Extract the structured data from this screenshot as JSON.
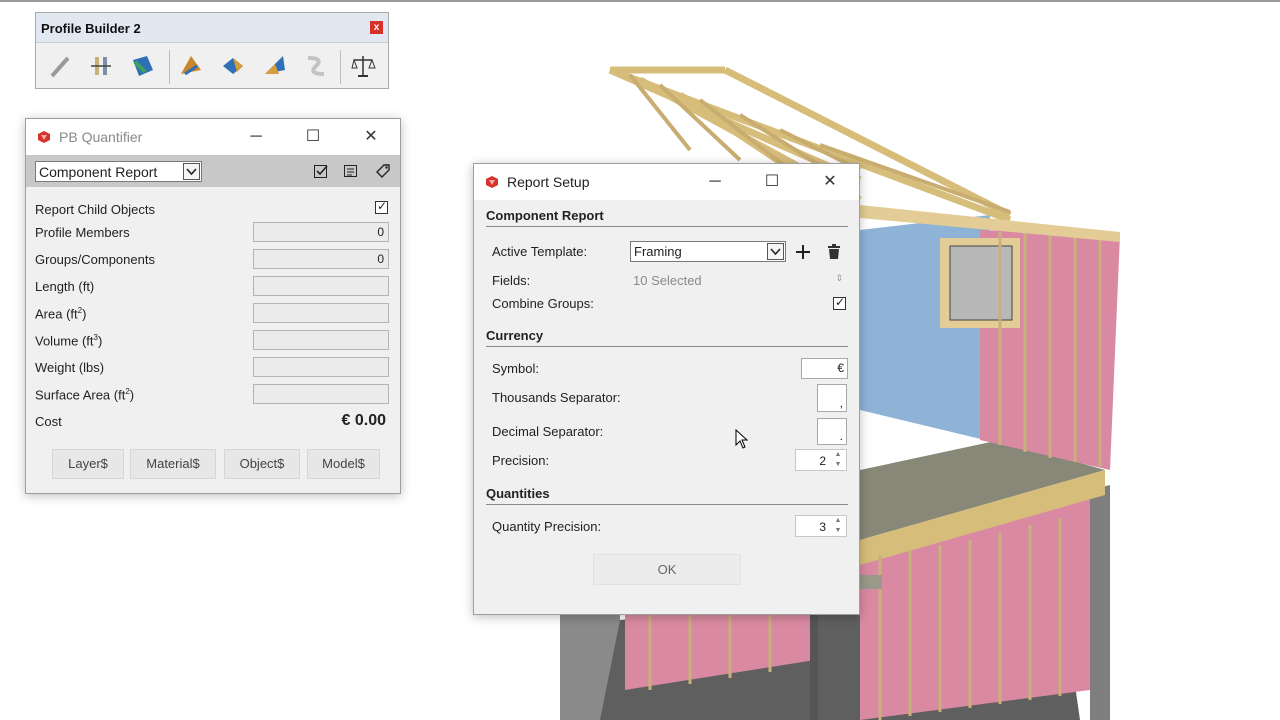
{
  "toolbar": {
    "title": "Profile Builder 2",
    "close": "x",
    "icons": [
      "pencil-tool-icon",
      "profile-member-icon",
      "paint-icon",
      "assembly-icon",
      "builder-icon",
      "material-icon",
      "path-icon",
      "quantifier-scale-icon"
    ]
  },
  "quantifier": {
    "title": "PB Quantifier",
    "report_type": "Component Report",
    "rows": {
      "child_objects_label": "Report Child Objects",
      "profile_members_label": "Profile Members",
      "profile_members_value": "0",
      "groups_label": "Groups/Components",
      "groups_value": "0",
      "length_label": "Length (ft)",
      "area_label": "Area (ft",
      "area_sup": "2",
      "volume_label": "Volume (ft",
      "volume_sup": "3",
      "weight_label": "Weight (lbs)",
      "surface_label": "Surface Area (ft",
      "surface_sup": "2",
      "cost_label": "Cost",
      "cost_value": "€ 0.00"
    },
    "buttons": [
      "Layer$",
      "Material$",
      "Object$",
      "Model$"
    ]
  },
  "setup": {
    "title": "Report Setup",
    "section_component": "Component Report",
    "active_template_label": "Active Template:",
    "active_template_value": "Framing",
    "fields_label": "Fields:",
    "fields_value": "10 Selected",
    "combine_label": "Combine Groups:",
    "section_currency": "Currency",
    "symbol_label": "Symbol:",
    "symbol_value": "€",
    "thousands_label": "Thousands Separator:",
    "thousands_value": ",",
    "decimal_label": "Decimal Separator:",
    "decimal_value": ".",
    "precision_label": "Precision:",
    "precision_value": "2",
    "section_quantities": "Quantities",
    "qty_precision_label": "Quantity Precision:",
    "qty_precision_value": "3",
    "ok_label": "OK"
  },
  "colors": {
    "insulation_pink": "#d98aa2",
    "wall_blue": "#8fb3d6",
    "lumber": "#e3cc95",
    "subfloor": "#9d9d8c",
    "ruby_red": "#d7332d"
  }
}
